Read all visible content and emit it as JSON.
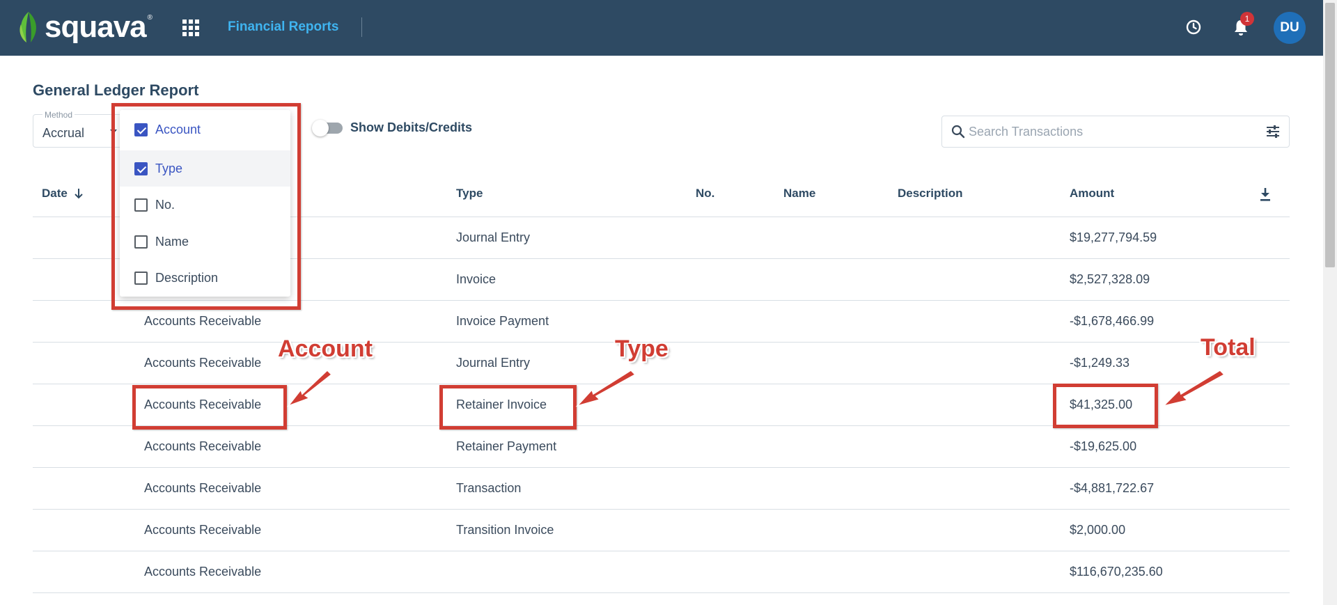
{
  "header": {
    "brand": "squava",
    "brand_mark": "®",
    "nav_title": "Financial Reports",
    "notification_count": "1",
    "avatar_initials": "DU",
    "colors": {
      "bar": "#2e4a63",
      "nav_title": "#3fb4f0",
      "badge": "#d13438",
      "avatar": "#1f6fb8"
    },
    "icons": [
      "squava-leaf-logo",
      "apps-grid-icon",
      "history-icon",
      "bell-icon"
    ]
  },
  "page": {
    "title": "General Ledger Report",
    "method": {
      "label": "Method",
      "value": "Accrual"
    },
    "toggle": {
      "label": "Show Debits/Credits",
      "on": false
    },
    "search": {
      "placeholder": "Search Transactions"
    }
  },
  "column_picker": {
    "items": [
      {
        "label": "Account",
        "checked": true
      },
      {
        "label": "Type",
        "checked": true
      },
      {
        "label": "No.",
        "checked": false
      },
      {
        "label": "Name",
        "checked": false
      },
      {
        "label": "Description",
        "checked": false
      }
    ]
  },
  "table": {
    "headers": {
      "date": "Date",
      "type": "Type",
      "no": "No.",
      "name": "Name",
      "description": "Description",
      "amount": "Amount"
    },
    "rows": [
      {
        "account": "",
        "type": "Journal Entry",
        "amount": "$19,277,794.59"
      },
      {
        "account": "",
        "type": "Invoice",
        "amount": "$2,527,328.09"
      },
      {
        "account": "Accounts Receivable",
        "type": "Invoice Payment",
        "amount": "-$1,678,466.99"
      },
      {
        "account": "Accounts Receivable",
        "type": "Journal Entry",
        "amount": "-$1,249.33"
      },
      {
        "account": "Accounts Receivable",
        "type": "Retainer Invoice",
        "amount": "$41,325.00"
      },
      {
        "account": "Accounts Receivable",
        "type": "Retainer Payment",
        "amount": "-$19,625.00"
      },
      {
        "account": "Accounts Receivable",
        "type": "Transaction",
        "amount": "-$4,881,722.67"
      },
      {
        "account": "Accounts Receivable",
        "type": "Transition Invoice",
        "amount": "$2,000.00"
      },
      {
        "account": "Accounts Receivable",
        "type": "",
        "amount": "$116,670,235.60"
      }
    ]
  },
  "annotations": {
    "account": "Account",
    "type": "Type",
    "total": "Total",
    "color": "#d13d33"
  }
}
